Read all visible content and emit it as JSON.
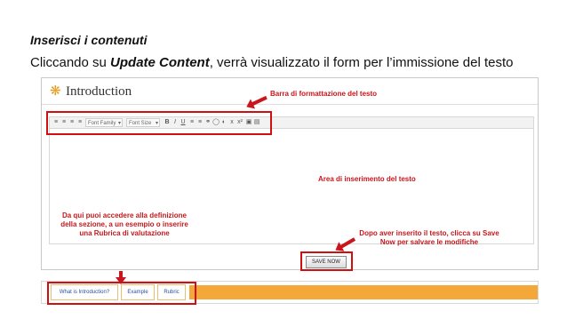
{
  "slide": {
    "title": "Inserisci i contenuti",
    "subtitle_pre": "Cliccando su ",
    "subtitle_bold": "Update Content",
    "subtitle_post": ", verrà visualizzato il form per l’immissione del testo"
  },
  "panel": {
    "title": "Introduction",
    "icon": "flower-icon"
  },
  "toolbar": {
    "font_family": "Font Family",
    "font_size": "Font Size",
    "bold": "B",
    "italic": "I",
    "underline": "U",
    "sub": "x",
    "sup": "x²"
  },
  "editor": {
    "save_label": "SAVE NOW"
  },
  "tabs": [
    {
      "label": "What is Introduction?"
    },
    {
      "label": "Example"
    },
    {
      "label": "Rubric"
    }
  ],
  "annotations": {
    "toolbar_note": "Barra di formattazione del testo",
    "textarea_note": "Area di inserimento del testo",
    "tabs_note": "Da qui puoi accedere alla definizione della sezione, a un esempio o inserire una Rubrica di valutazione",
    "save_note": "Dopo aver inserito il testo, clicca su Save Now per salvare le modifiche"
  },
  "colors": {
    "annotation_red": "#c8161c",
    "tab_bar_orange": "#f5a83a",
    "flower_orange": "#e69b1e",
    "tab_link_blue": "#2a4f9e"
  }
}
